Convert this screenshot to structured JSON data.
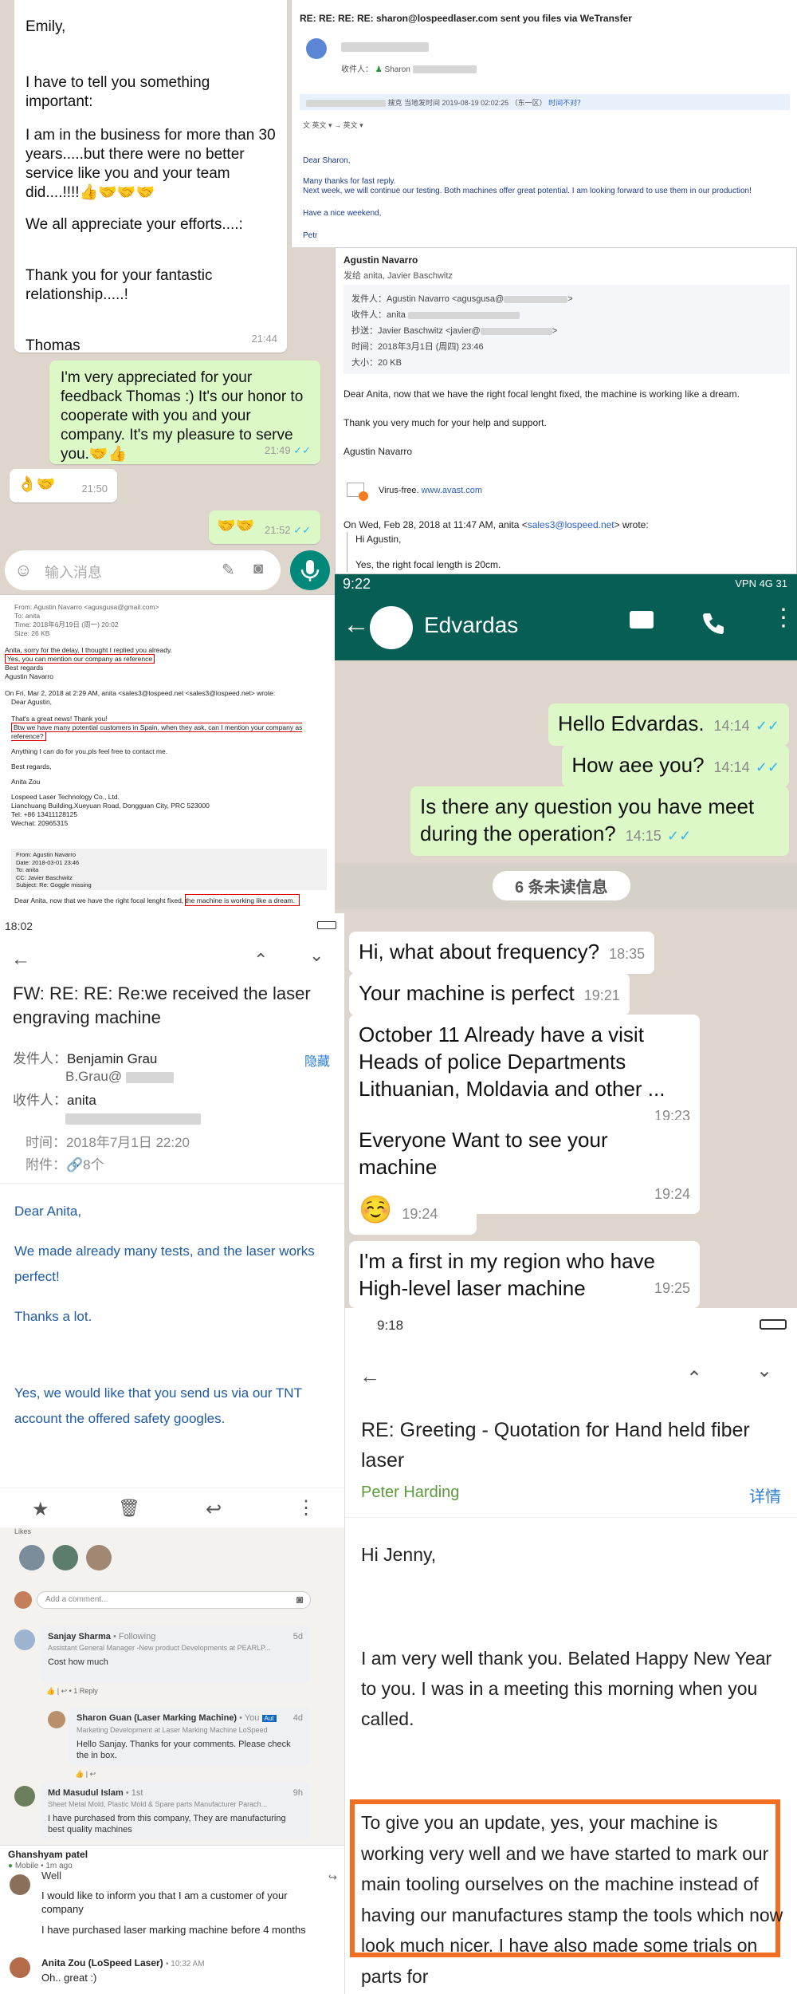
{
  "wa1": {
    "msg1_lines": [
      "Emily,",
      "I have to tell you something important:",
      "I am in the business for more than 30 years.....but there were no better service like you and your team did....!!!!👍🤝🤝🤝",
      "We all appreciate your efforts....:",
      "Thank you for your fantastic relationship.....!",
      "Thomas"
    ],
    "msg1_time": "21:44",
    "msg2": "I'm very appreciated for your feedback Thomas :) It's our honor to cooperate with you and your company. It's my pleasure to serve you.🤝👍",
    "msg2_time": "21:49",
    "msg3": "👌🤝",
    "msg3_time": "21:50",
    "msg4": "🤝🤝",
    "msg4_time": "21:52",
    "input_placeholder": "输入消息"
  },
  "email1": {
    "subject": "RE: RE: RE: RE: sharon@lospeedlaser.com sent you files via WeTransfer",
    "to_label": "收件人：",
    "to_name": "Sharon",
    "meta_time": "2019-08-19 02:02:25 （东一区）",
    "meta_link": "时间不对？",
    "meta_prefix": "搜克 当地发时间",
    "lang_from": "英文",
    "lang_to": "英文",
    "greeting": "Dear Sharon,",
    "body1": "Many thanks for fast reply.",
    "body2": "Next week, we will continue our testing. Both machines offer great potential. I am looking forward to use them in our production!",
    "body3": "Have a nice weekend,",
    "sign": "Petr"
  },
  "email2": {
    "sender": "Agustin Navarro",
    "recipients": "发给 anita, Javier Baschwitz",
    "from_line": "发件人：Agustin Navarro <agusgusa@",
    "to_line": "收件人：anita",
    "cc_line": "抄送：Javier Baschwitz <javier@",
    "date_line": "时间：2018年3月1日 (周四) 23:46",
    "size_line": "大小：20 KB",
    "body1": "Dear Anita, now that we have the right focal lenght fixed, the machine is working like a dream.",
    "body2": "Thank you very much for your help and support.",
    "sign": "Agustin Navarro",
    "virus_text": "Virus-free.",
    "virus_link": "www.avast.com",
    "quote_head": "On Wed, Feb 28, 2018 at 11:47 AM, anita <",
    "quote_email": "sales3@lospeed.net",
    "quote_tail": "> wrote:",
    "quote1": "Hi Agustin,",
    "quote2": "Yes, the right focal length is 20cm."
  },
  "email3": {
    "line1": "From: Agustin Navarro <agusgusa@gmail.com>",
    "line2": "To: anita",
    "line3": "Time: 2018年6月19日 (周一) 20:02",
    "line4": "Size: 26 KB",
    "body1": "Anita, sorry for the delay, I thought I replied you already.",
    "body2": "Yes, you can mention our company as reference",
    "body3": "Best regards",
    "body4": "Agustin Navarro",
    "quote_head": "On Fri, Mar 2, 2018 at 2:29 AM, anita <sales3@lospeed.net <sales3@lospeed.net> wrote:",
    "q1": "Dear Agustin,",
    "q2": "That's a great news! Thank you!",
    "q3": "Btw we have many potential customers in Spain, when they ask, can I mention your company as reference?",
    "q4": "Anything I can do for you,pls feel free to contact me.",
    "q5": "Best regards,",
    "q6": "Anita Zou",
    "addr1": "Lospeed Laser Technology Co., Ltd.",
    "addr2": "Lianchuang Building,Xueyuan Road, Dongguan City, PRC 523000",
    "addr3": "Tel: +86 13411128125",
    "addr4": "Wechat: 20965315",
    "f_from": "From: Agustin Navarro",
    "f_date": "Date: 2018-03-01 23:46",
    "f_to": "To: anita",
    "f_cc": "CC: Javier Baschwitz",
    "f_subject": "Subject: Re: Goggle missing",
    "bottom": "Dear Anita, now that we have the right focal lenght fixed, the machine is working like a dream."
  },
  "wa2": {
    "status_time": "9:22",
    "status_right": "VPN 4G 31",
    "contact": "Edvardas",
    "m1": "Hello Edvardas.",
    "m1t": "14:14",
    "m2": "How aee you?",
    "m2t": "14:14",
    "m3": "Is there any question you have meet during the operation?",
    "m3t": "14:15",
    "unread": "6 条未读信息",
    "r1": "Hi, what about frequency?",
    "r1t": "18:35",
    "r2": "Your machine is perfect",
    "r2t": "19:21",
    "r3": "October 11 Already have a visit Heads of police Departments Lithuanian, Moldavia and other ...",
    "r3t": "19:23",
    "r4": "Everyone Want to see your machine",
    "r4t": "19:24",
    "r5": "☺️",
    "r5t": "19:24",
    "r6": "I'm a first in my region who have High-level laser machine",
    "r6t": "19:25"
  },
  "email4": {
    "status_time": "18:02",
    "subject": "FW: RE: RE: Re:we received the laser engraving machine",
    "from_label": "发件人：",
    "from_name": "Benjamin Grau",
    "from_email": "B.Grau@",
    "hide": "隐藏",
    "to_label": "收件人：",
    "to_name": "anita",
    "time_label": "时间：",
    "time_val": "2018年7月1日 22:20",
    "att_label": "附件：",
    "att_val": "8个",
    "greeting": "Dear Anita,",
    "body1": "We made already many tests, and the laser works perfect!",
    "body2": "Thanks a lot.",
    "body3": "Yes, we would like that you send us via our TNT account the offered safety googles."
  },
  "email5": {
    "status_time": "9:18",
    "subject": "RE: Greeting - Quotation for Hand held fiber laser",
    "sender": "Peter Harding",
    "detail": "详情",
    "greeting": "Hi Jenny,",
    "body1": "I am very well thank you. Belated Happy New Year to you. I was in a meeting this morning when you called.",
    "body2": "To give you an update, yes, your machine is working very well and we have started to mark our main tooling ourselves on the machine instead of having our manufactures stamp the tools which now look much nicer. I have also made some trials on parts for"
  },
  "linkedin": {
    "likes_label": "Likes",
    "comment_placeholder": "Add a comment...",
    "c1_name": "Sanjay Sharma",
    "c1_rel": "• Following",
    "c1_title": "Assistant General Manager -New product Developments at PEARLP...",
    "c1_time": "5d",
    "c1_text": "Cost how much",
    "c1_reply": "1 Reply",
    "c2_name": "Sharon Guan (Laser Marking Machine)",
    "c2_badge": "Aut",
    "c2_you": "• You",
    "c2_title": "Marketing Development at Laser Marking Machine LoSpeed",
    "c2_time": "4d",
    "c2_text": "Hello Sanjay. Thanks for your comments. Please check the in box.",
    "c3_name": "Md Masudul Islam",
    "c3_rel": "• 1st",
    "c3_title": "Sheet Metal Mold, Plastic Mold & Spare parts Manufacturer Parach...",
    "c3_time": "9h",
    "c3_text": "I have purchased from this company, They are manufacturing best quality machines",
    "c4_name": "Ghanshyam patel",
    "c4_sub": "Mobile • 1m ago",
    "c4_prev": "Well",
    "c4_text1": "I would like to inform you that I am a customer of your company",
    "c4_text2": "I have purchased laser marking machine before 4 months",
    "c5_name": "Anita Zou (LoSpeed Laser)",
    "c5_time": "• 10:32 AM",
    "c5_text": "Oh.. great :)"
  }
}
